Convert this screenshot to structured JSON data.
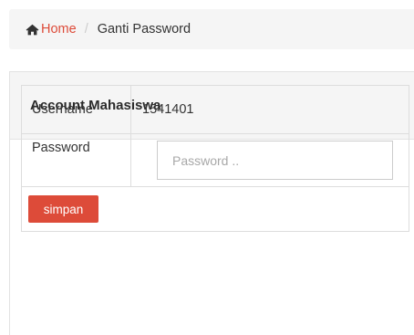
{
  "breadcrumb": {
    "home_icon": "home-icon",
    "home_label": "Home",
    "separator": "/",
    "current": "Ganti Password"
  },
  "panel": {
    "title": "Account Mahasiswa"
  },
  "form": {
    "username_label": "Username",
    "username_value": "1541401",
    "password_label": "Password",
    "password_placeholder": "Password ..",
    "submit_label": "simpan"
  },
  "colors": {
    "accent": "#dd4b39",
    "breadcrumb_bg": "#f5f5f5",
    "panel_heading_bg": "#f5f5f5"
  }
}
